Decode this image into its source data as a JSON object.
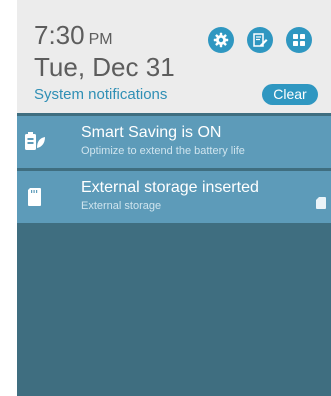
{
  "header": {
    "time": "7:30",
    "ampm": "PM",
    "date": "Tue, Dec 31",
    "system_notifications": "System notifications",
    "clear_label": "Clear",
    "quick_buttons": [
      "settings-icon",
      "edit-icon",
      "grid-icon"
    ]
  },
  "notifications": [
    {
      "icon": "battery-leaf-icon",
      "title": "Smart Saving is ON",
      "subtitle": "Optimize to extend the battery life"
    },
    {
      "icon": "sd-card-icon",
      "title": "External storage inserted",
      "subtitle": "External storage",
      "trailing_icon": "sd-card-small-icon"
    }
  ],
  "colors": {
    "header_bg": "#ececec",
    "accent": "#2f97c1",
    "notification_bg": "#5d9bb9",
    "shade_bg": "#3f6e80"
  }
}
